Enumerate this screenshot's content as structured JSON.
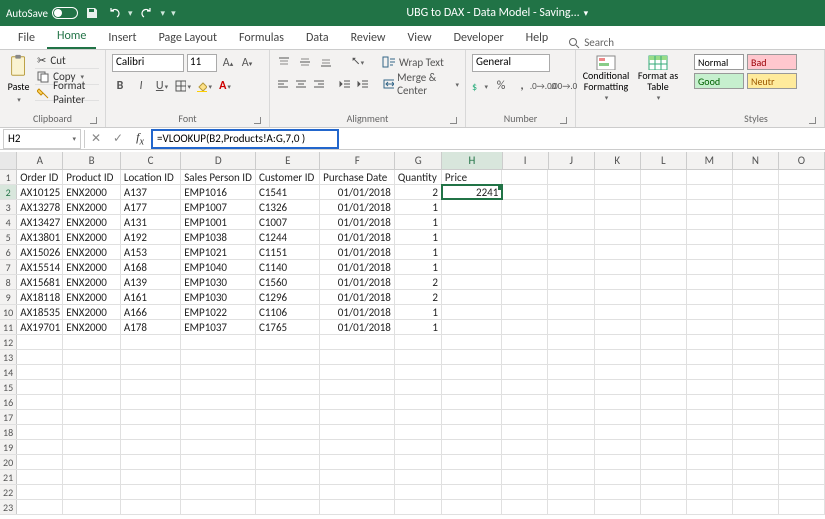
{
  "titlebar": {
    "autosave": "AutoSave",
    "toggle": "On",
    "title": "UBG to DAX - Data Model - Saving..."
  },
  "tabs": {
    "file": "File",
    "home": "Home",
    "insert": "Insert",
    "pagelayout": "Page Layout",
    "formulas": "Formulas",
    "data": "Data",
    "review": "Review",
    "view": "View",
    "developer": "Developer",
    "help": "Help",
    "search": "Search"
  },
  "ribbon": {
    "clipboard": {
      "paste": "Paste",
      "cut": "Cut",
      "copy": "Copy",
      "fmtpainter": "Format Painter",
      "label": "Clipboard"
    },
    "font": {
      "name": "Calibri",
      "size": "11",
      "label": "Font"
    },
    "alignment": {
      "wrap": "Wrap Text",
      "merge": "Merge & Center",
      "label": "Alignment"
    },
    "number": {
      "format": "General",
      "label": "Number"
    },
    "cond": {
      "cf": "Conditional Formatting",
      "fat": "Format as Table"
    },
    "styles": {
      "normal": "Normal",
      "bad": "Bad",
      "good": "Good",
      "neutral": "Neutr",
      "label": "Styles"
    }
  },
  "formulabar": {
    "cellref": "H2",
    "formula": "=VLOOKUP(B2,Products!A:G,7,0 )"
  },
  "columns": [
    "A",
    "B",
    "C",
    "D",
    "E",
    "F",
    "G",
    "H",
    "I",
    "J",
    "K",
    "L",
    "M",
    "N",
    "O"
  ],
  "headers": {
    "A": "Order ID",
    "B": "Product ID",
    "C": "Location ID",
    "D": "Sales Person ID",
    "E": "Customer ID",
    "F": "Purchase Date",
    "G": "Quantity",
    "H": "Price"
  },
  "rows": [
    {
      "A": "AX10125",
      "B": "ENX2000",
      "C": "A137",
      "D": "EMP1016",
      "E": "C1541",
      "F": "01/01/2018",
      "G": "2",
      "H": "2241"
    },
    {
      "A": "AX13278",
      "B": "ENX2000",
      "C": "A177",
      "D": "EMP1007",
      "E": "C1326",
      "F": "01/01/2018",
      "G": "1",
      "H": ""
    },
    {
      "A": "AX13427",
      "B": "ENX2000",
      "C": "A131",
      "D": "EMP1001",
      "E": "C1007",
      "F": "01/01/2018",
      "G": "1",
      "H": ""
    },
    {
      "A": "AX13801",
      "B": "ENX2000",
      "C": "A192",
      "D": "EMP1038",
      "E": "C1244",
      "F": "01/01/2018",
      "G": "1",
      "H": ""
    },
    {
      "A": "AX15026",
      "B": "ENX2000",
      "C": "A153",
      "D": "EMP1021",
      "E": "C1151",
      "F": "01/01/2018",
      "G": "1",
      "H": ""
    },
    {
      "A": "AX15514",
      "B": "ENX2000",
      "C": "A168",
      "D": "EMP1040",
      "E": "C1140",
      "F": "01/01/2018",
      "G": "1",
      "H": ""
    },
    {
      "A": "AX15681",
      "B": "ENX2000",
      "C": "A139",
      "D": "EMP1030",
      "E": "C1560",
      "F": "01/01/2018",
      "G": "2",
      "H": ""
    },
    {
      "A": "AX18118",
      "B": "ENX2000",
      "C": "A161",
      "D": "EMP1030",
      "E": "C1296",
      "F": "01/01/2018",
      "G": "2",
      "H": ""
    },
    {
      "A": "AX18535",
      "B": "ENX2000",
      "C": "A166",
      "D": "EMP1022",
      "E": "C1106",
      "F": "01/01/2018",
      "G": "1",
      "H": ""
    },
    {
      "A": "AX19701",
      "B": "ENX2000",
      "C": "A178",
      "D": "EMP1037",
      "E": "C1765",
      "F": "01/01/2018",
      "G": "1",
      "H": ""
    }
  ],
  "selected": {
    "col": "H",
    "row": 2
  }
}
